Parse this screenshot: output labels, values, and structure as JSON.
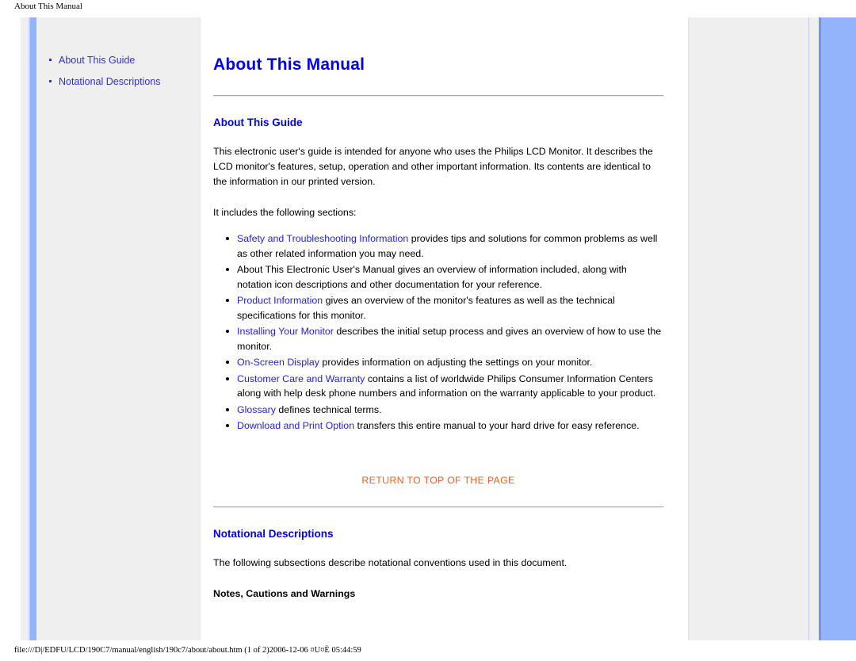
{
  "browser": {
    "header_title": "About This Manual",
    "footer_path": "file:///D|/EDFU/LCD/190C7/manual/english/190c7/about/about.htm (1 of 2)2006-12-06 ¤U¤È 05:44:59"
  },
  "colors": {
    "link_blue": "#2424d6",
    "heading_blue": "#0000ee",
    "nav_blue": "#3333cc",
    "accent_bar": "#93b4fa",
    "return_orange": "#f4601f",
    "panel_gray": "#efefef"
  },
  "sidebar": {
    "items": [
      {
        "label": "About This Guide"
      },
      {
        "label": "Notational Descriptions"
      }
    ]
  },
  "main": {
    "title": "About This Manual",
    "sections": {
      "about_guide": {
        "heading": "About This Guide",
        "intro": "This electronic user's guide is intended for anyone who uses the Philips LCD Monitor. It describes the LCD monitor's features, setup, operation and other important information. Its contents are identical to the information in our printed version.",
        "includes_lead": "It includes the following sections:",
        "list": [
          {
            "link": "Safety and Troubleshooting Information",
            "text": " provides tips and solutions for common problems as well as other related information you may need."
          },
          {
            "link": "",
            "text": "About This Electronic User's Manual gives an overview of information included, along with notation icon descriptions and other documentation for your reference."
          },
          {
            "link": "Product Information",
            "text": " gives an overview of the monitor's features as well as the technical specifications for this monitor."
          },
          {
            "link": "Installing Your Monitor",
            "text": " describes the initial setup process and gives an overview of how to use the monitor."
          },
          {
            "link": "On-Screen Display",
            "text": " provides information on adjusting the settings on your monitor."
          },
          {
            "link": "Customer Care and Warranty",
            "text": " contains a list of worldwide Philips Consumer Information Centers along with help desk phone numbers and information on the warranty applicable to your product."
          },
          {
            "link": "Glossary",
            "text": " defines technical terms."
          },
          {
            "link": "Download and Print Option",
            "text": " transfers this entire manual to your hard drive for easy reference."
          }
        ],
        "return_to_top": "RETURN TO TOP OF THE PAGE"
      },
      "notational": {
        "heading": "Notational Descriptions",
        "intro": "The following subsections describe notational conventions used in this document.",
        "subheading": "Notes, Cautions and Warnings"
      }
    }
  }
}
